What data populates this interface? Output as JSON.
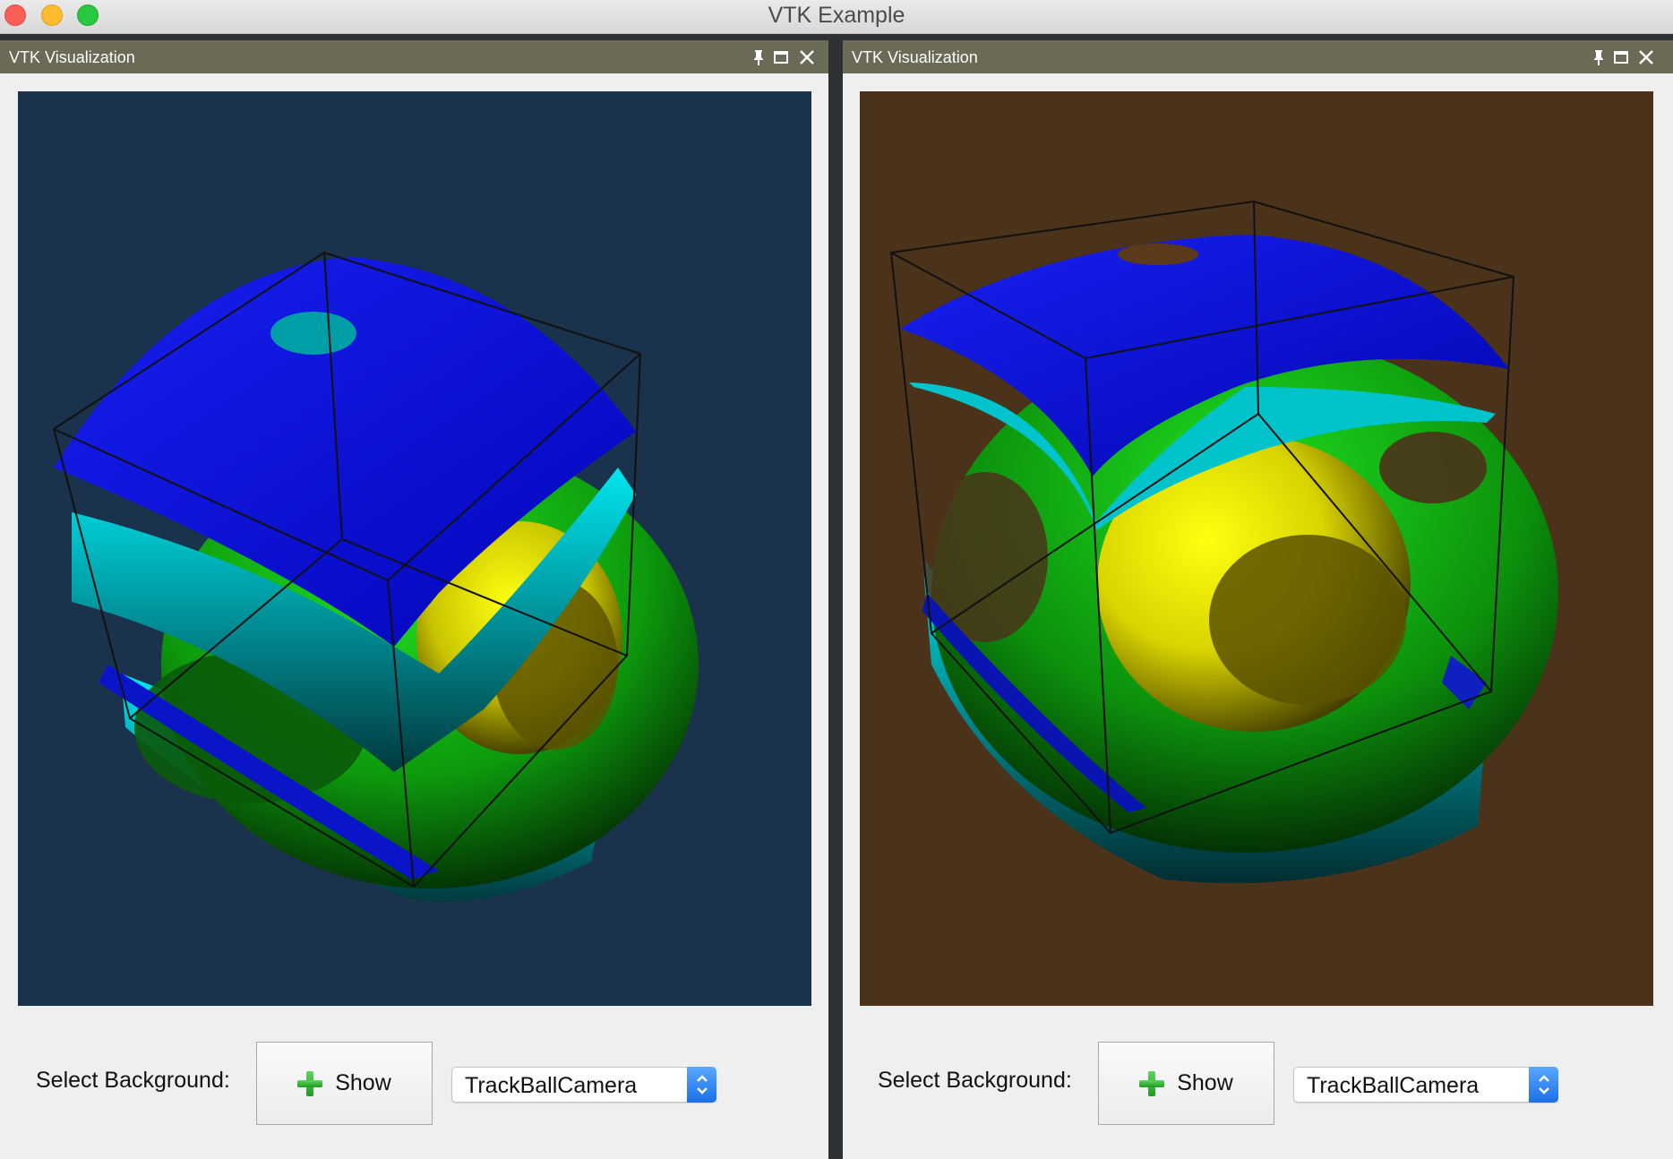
{
  "window": {
    "title": "VTK Example"
  },
  "docks": [
    {
      "title": "VTK Visualization",
      "background_color": "#1b324d",
      "select_label": "Select Background:",
      "show_label": "Show",
      "combo_value": "TrackBallCamera"
    },
    {
      "title": "VTK Visualization",
      "background_color": "#4b321a",
      "select_label": "Select Background:",
      "show_label": "Show",
      "combo_value": "TrackBallCamera"
    }
  ],
  "icons": {
    "dock_buttons": [
      "pin-icon",
      "float-icon",
      "close-icon"
    ],
    "show_button": "plus-icon",
    "combo": "up-down-arrows-icon"
  },
  "colors": {
    "dock_header": "#6a6a56",
    "surface_blue": "#0b0fd8",
    "surface_cyan": "#00d6dc",
    "surface_green": "#12c912",
    "surface_yellow": "#e9e600"
  }
}
